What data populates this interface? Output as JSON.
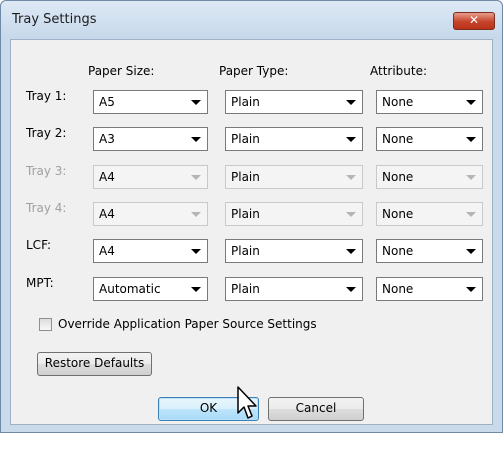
{
  "dialog": {
    "title": "Tray Settings",
    "close_glyph": "✕",
    "column_headers": {
      "paper_size": "Paper Size:",
      "paper_type": "Paper Type:",
      "attribute": "Attribute:"
    },
    "rows": [
      {
        "label": "Tray 1:",
        "paper_size": "A5",
        "paper_type": "Plain",
        "attribute": "None",
        "enabled": true
      },
      {
        "label": "Tray 2:",
        "paper_size": "A3",
        "paper_type": "Plain",
        "attribute": "None",
        "enabled": true
      },
      {
        "label": "Tray 3:",
        "paper_size": "A4",
        "paper_type": "Plain",
        "attribute": "None",
        "enabled": false
      },
      {
        "label": "Tray 4:",
        "paper_size": "A4",
        "paper_type": "Plain",
        "attribute": "None",
        "enabled": false
      },
      {
        "label": "LCF:",
        "paper_size": "A4",
        "paper_type": "Plain",
        "attribute": "None",
        "enabled": true
      },
      {
        "label": "MPT:",
        "paper_size": "Automatic",
        "paper_type": "Plain",
        "attribute": "None",
        "enabled": true
      }
    ],
    "override_checkbox": {
      "label": "Override Application Paper Source Settings",
      "checked": false
    },
    "restore_defaults_label": "Restore Defaults",
    "ok_label": "OK",
    "cancel_label": "Cancel"
  },
  "colors": {
    "frame": "#c9daea",
    "client": "#f0f0f0",
    "close": "#c6432a",
    "disabled_text": "#a0a0a0"
  }
}
